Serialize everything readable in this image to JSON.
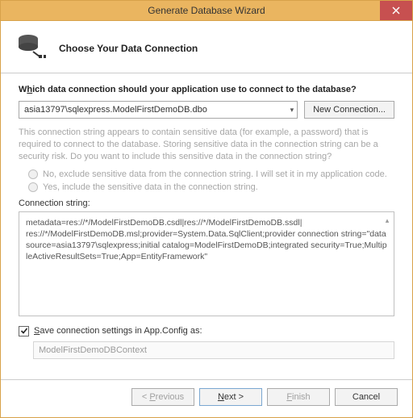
{
  "window": {
    "title": "Generate Database Wizard"
  },
  "header": {
    "heading": "Choose Your Data Connection"
  },
  "main": {
    "prompt_pre": "W",
    "prompt_u": "h",
    "prompt_post": "ich data connection should your application use to connect to the database?",
    "connection_selected": "asia13797\\sqlexpress.ModelFirstDemoDB.dbo",
    "new_connection_label": "New Connection...",
    "sensitive_info": "This connection string appears to contain sensitive data (for example, a password) that is required to connect to the database. Storing sensitive data in the connection string can be a security risk. Do you want to include this sensitive data in the connection string?",
    "radio_exclude_pre": "No, e",
    "radio_exclude_u": "x",
    "radio_exclude_post": "clude sensitive data from the connection string. I will set it in my application code.",
    "radio_include_pre": "Yes, ",
    "radio_include_u": "i",
    "radio_include_post": "nclude the sensitive data in the connection string.",
    "cs_label": "Connection string:",
    "connection_string": "metadata=res://*/ModelFirstDemoDB.csdl|res://*/ModelFirstDemoDB.ssdl|\nres://*/ModelFirstDemoDB.msl;provider=System.Data.SqlClient;provider connection string=\"data source=asia13797\\sqlexpress;initial catalog=ModelFirstDemoDB;integrated security=True;MultipleActiveResultSets=True;App=EntityFramework\"",
    "save_u": "S",
    "save_post": "ave connection settings in App.Config as:",
    "context_name": "ModelFirstDemoDBContext"
  },
  "footer": {
    "previous_pre": "< ",
    "previous_u": "P",
    "previous_post": "revious",
    "next_u": "N",
    "next_post": "ext >",
    "finish_u": "F",
    "finish_post": "inish",
    "cancel": "Cancel"
  }
}
